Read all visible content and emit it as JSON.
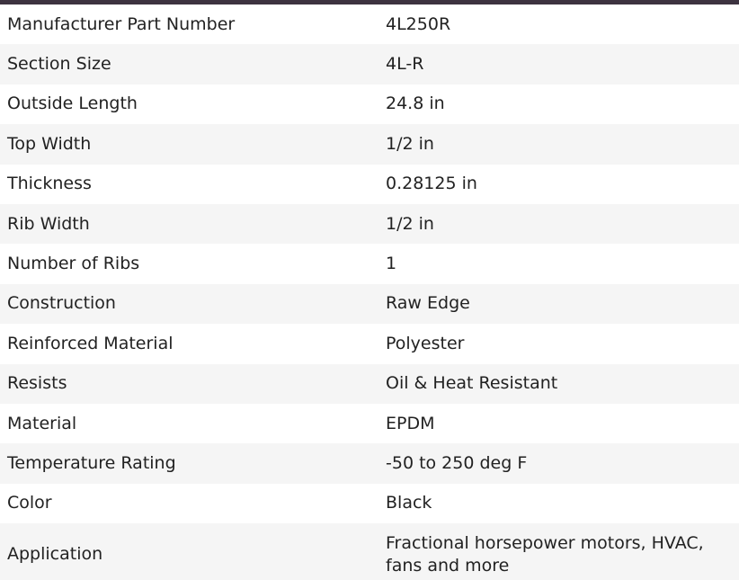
{
  "specs": {
    "rows": [
      {
        "label": "Manufacturer Part Number",
        "value": "4L250R"
      },
      {
        "label": "Section Size",
        "value": "4L-R"
      },
      {
        "label": "Outside Length",
        "value": "24.8 in"
      },
      {
        "label": "Top Width",
        "value": "1/2 in"
      },
      {
        "label": "Thickness",
        "value": "0.28125 in"
      },
      {
        "label": "Rib Width",
        "value": "1/2 in"
      },
      {
        "label": "Number of Ribs",
        "value": "1"
      },
      {
        "label": "Construction",
        "value": "Raw Edge"
      },
      {
        "label": "Reinforced Material",
        "value": "Polyester"
      },
      {
        "label": "Resists",
        "value": "Oil & Heat Resistant"
      },
      {
        "label": "Material",
        "value": "EPDM"
      },
      {
        "label": "Temperature Rating",
        "value": "-50 to 250 deg F"
      },
      {
        "label": "Color",
        "value": "Black"
      },
      {
        "label": "Application",
        "value": "Fractional horsepower motors, HVAC, fans and more"
      }
    ]
  },
  "colors": {
    "top_bar": "#3d3340",
    "stripe": "#f5f5f5",
    "text": "#222222"
  }
}
